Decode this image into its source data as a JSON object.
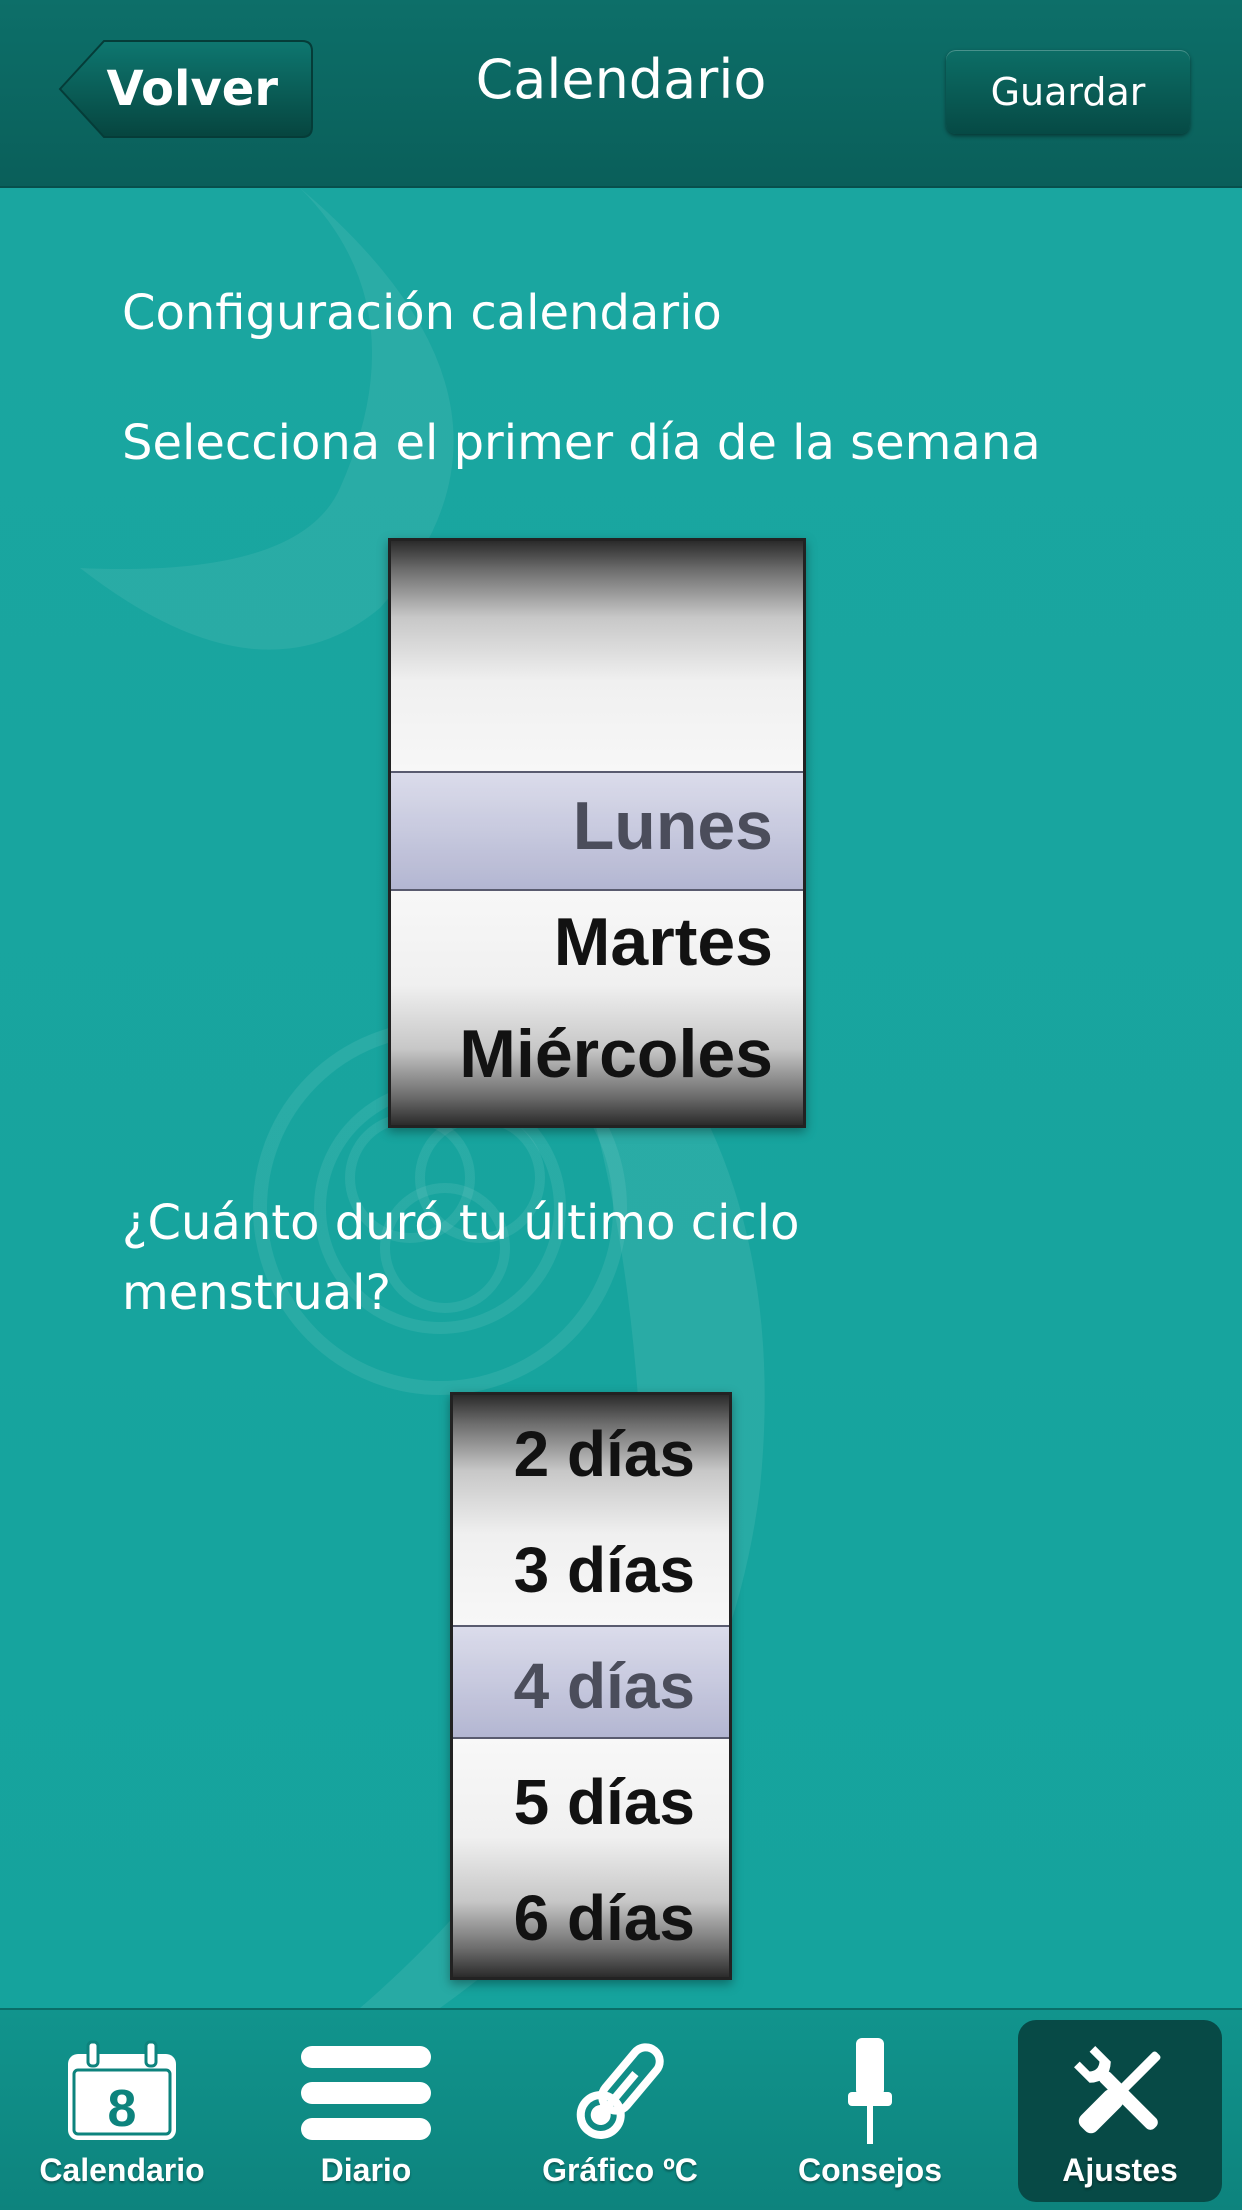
{
  "header": {
    "back_label": "Volver",
    "title": "Calendario",
    "save_label": "Guardar"
  },
  "settings": {
    "section_title": "Configuración calendario",
    "first_day_prompt": "Selecciona el primer día de la semana",
    "cycle_prompt_line1": "¿Cuánto duró tu último ciclo",
    "cycle_prompt_line2": "menstrual?"
  },
  "weekday_picker": {
    "options": [
      "Lunes",
      "Martes",
      "Miércoles"
    ],
    "selected": "Lunes"
  },
  "cycle_picker": {
    "options": [
      "2 días",
      "3 días",
      "4 días",
      "5 días",
      "6 días"
    ],
    "selected": "4 días"
  },
  "tabbar": {
    "items": [
      {
        "label": "Calendario",
        "icon": "calendar-icon",
        "badge": "8",
        "active": false
      },
      {
        "label": "Diario",
        "icon": "list-icon",
        "active": false
      },
      {
        "label": "Gráfico ºC",
        "icon": "thermometer-icon",
        "active": false
      },
      {
        "label": "Consejos",
        "icon": "pin-icon",
        "active": false
      },
      {
        "label": "Ajustes",
        "icon": "tools-icon",
        "active": true
      }
    ]
  },
  "colors": {
    "background": "#17a59f",
    "header": "#0b6660",
    "active_tab": "#074a46",
    "selection_bar": "#c3c5dd"
  }
}
